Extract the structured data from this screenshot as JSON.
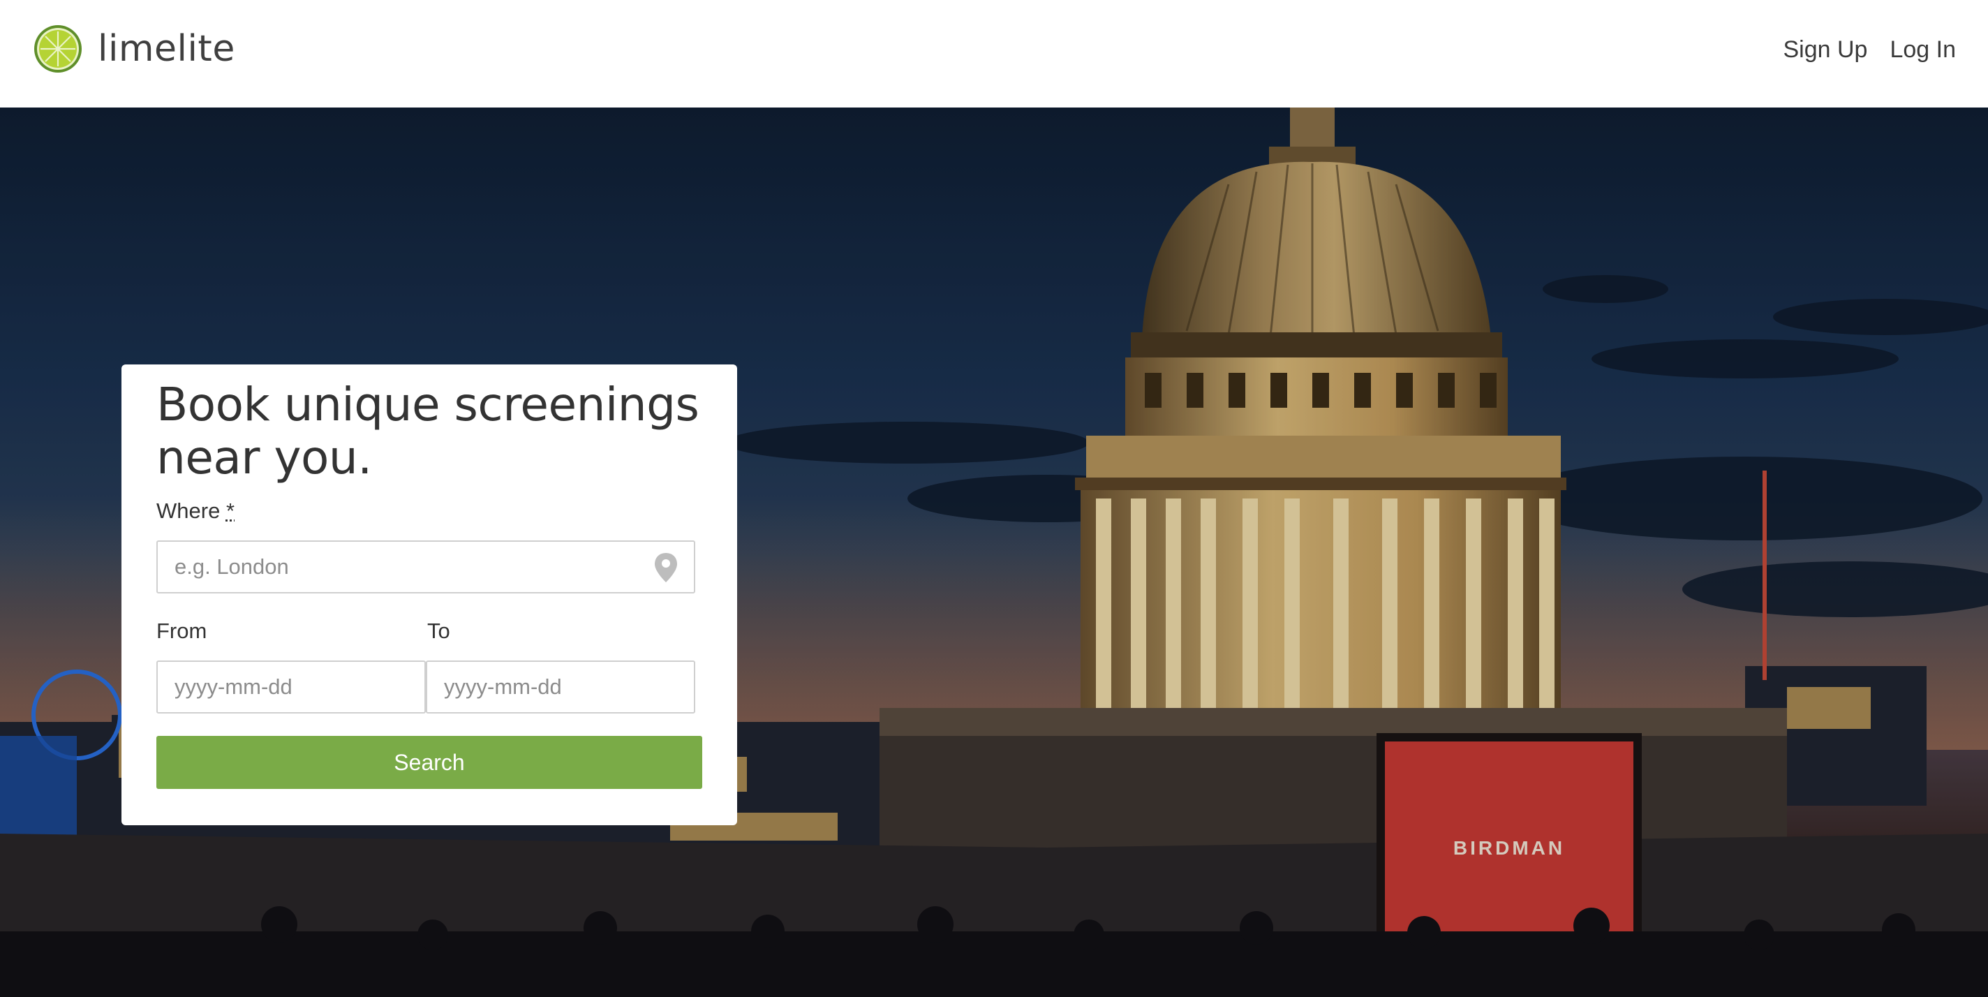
{
  "brand": {
    "name": "limelite",
    "logo_icon": "lime-slice-icon",
    "accent": "#7aab47"
  },
  "nav": {
    "sign_up": "Sign Up",
    "log_in": "Log In"
  },
  "hero": {
    "background": "St Paul's Cathedral rooftop cinema at dusk",
    "poster_title": "BIRDMAN"
  },
  "search": {
    "title": "Book unique screenings near you.",
    "where_label": "Where",
    "required_mark": "*",
    "where_placeholder": "e.g. London",
    "where_icon": "map-pin-icon",
    "from_label": "From",
    "from_placeholder": "yyyy-mm-dd",
    "to_label": "To",
    "to_placeholder": "yyyy-mm-dd",
    "button_label": "Search",
    "button_color": "#7aab47"
  }
}
